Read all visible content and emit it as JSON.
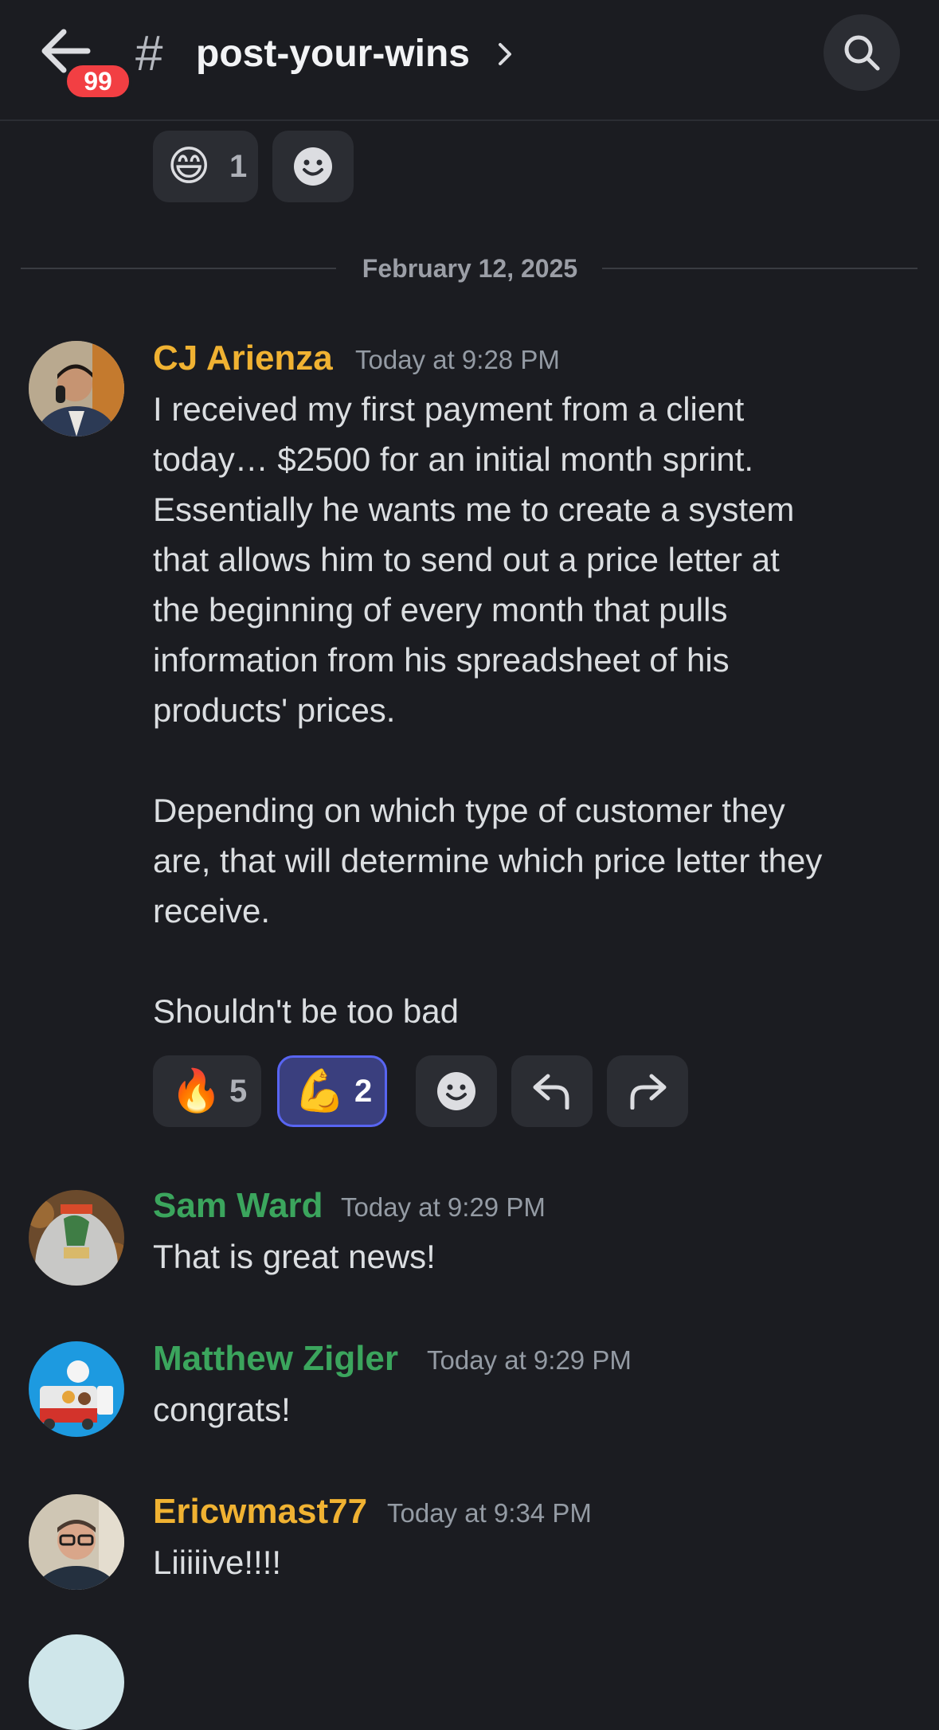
{
  "header": {
    "channel_name": "post-your-wins",
    "hash": "#",
    "unread_badge": "99",
    "back_icon": "arrow-left-icon",
    "search_icon": "search-icon"
  },
  "top_reactions": [
    {
      "emoji": "😄",
      "count": "1"
    }
  ],
  "date_divider": "February 12, 2025",
  "messages": [
    {
      "author": "CJ Arienza",
      "author_color": "#f0b232",
      "time": "Today at 9:28 PM",
      "lines": [
        "I received my first payment from a client",
        "today… $2500 for an initial month sprint.",
        "Essentially he wants me to create a system",
        "that allows him to send out a price letter at",
        "the beginning of every month that pulls",
        "information from his spreadsheet of his",
        "products' prices.",
        "",
        "Depending on which type of customer they",
        "are, that will determine which price letter they",
        "receive.",
        "",
        "Shouldn't be too bad"
      ],
      "reactions": [
        {
          "emoji": "🔥",
          "count": "5"
        },
        {
          "emoji": "💪",
          "count": "2"
        }
      ]
    },
    {
      "author": "Sam Ward",
      "author_color": "#3ba55d",
      "time": "Today at 9:29 PM",
      "text": "That is great news!"
    },
    {
      "author": "Matthew Zigler",
      "author_color": "#3ba55d",
      "time": "Today at 9:29 PM",
      "text": "congrats!"
    },
    {
      "author": "Ericwmast77",
      "author_color": "#f0b232",
      "time": "Today at 9:34 PM",
      "text": "Liiiiive!!!!"
    }
  ]
}
